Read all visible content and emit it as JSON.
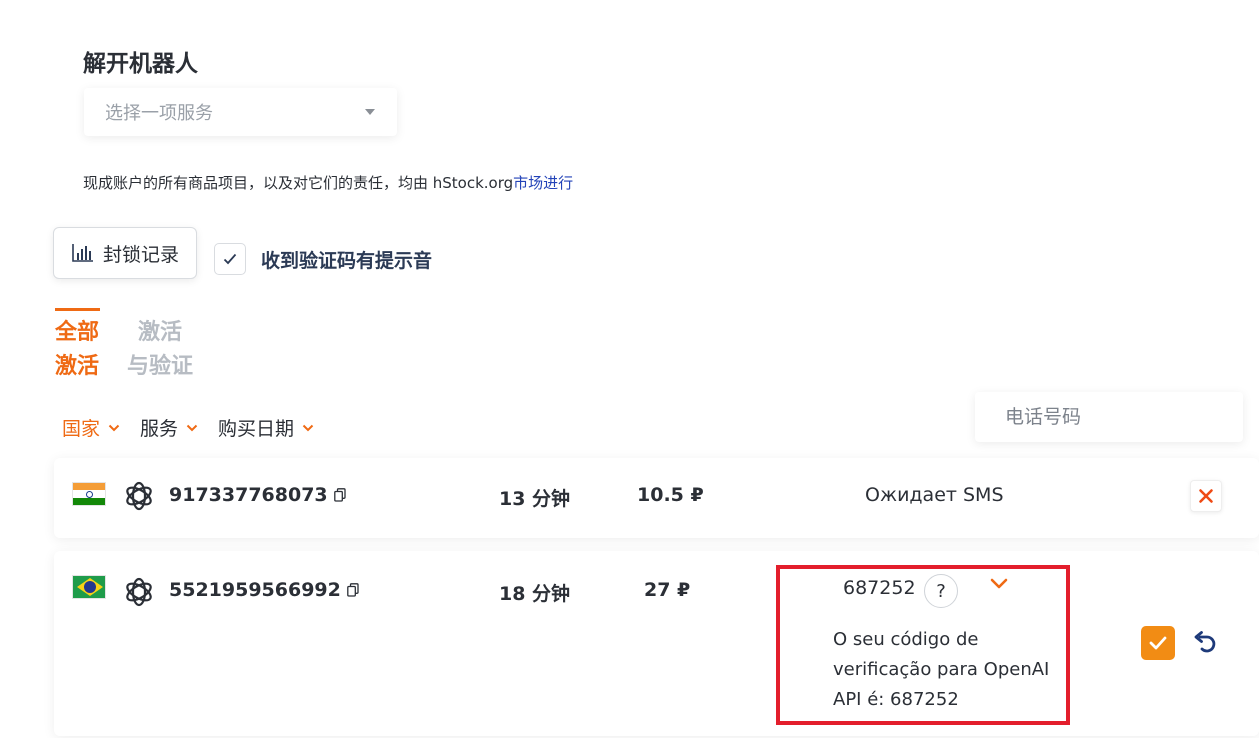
{
  "page": {
    "title": "解开机器人"
  },
  "service_select": {
    "placeholder": "选择一项服务"
  },
  "notice": {
    "text": "现成账户的所有商品项目，以及对它们的责任，均由 hStock.org",
    "link": "市场进行"
  },
  "block_log": {
    "label": "封锁记录"
  },
  "sound": {
    "checked": true,
    "label": "收到验证码有提示音"
  },
  "tabs": [
    {
      "line1": "全部",
      "line2": "激活",
      "active": true
    },
    {
      "line1": "激活",
      "line2": "与验证",
      "active": false
    }
  ],
  "filters": [
    {
      "label": "国家",
      "active": true
    },
    {
      "label": "服务",
      "active": false
    },
    {
      "label": "购买日期",
      "active": false
    }
  ],
  "phone_search": {
    "placeholder": "电话号码"
  },
  "rows": [
    {
      "country": "India",
      "service_icon": "openai-icon",
      "number": "917337768073",
      "duration": "13 分钟",
      "price": "10.5 ₽",
      "status": "Ожидает SMS",
      "action": "cancel"
    },
    {
      "country": "Brazil",
      "service_icon": "openai-icon",
      "number": "5521959566992",
      "duration": "18 分钟",
      "price": "27 ₽",
      "code": "687252",
      "help": "?",
      "sms": "O seu código de verificação para OpenAI API é: 687252",
      "action": "confirm"
    }
  ],
  "colors": {
    "accent": "#ef6a14",
    "confirm": "#f28c14",
    "link": "#2343b8",
    "highlight": "#e31e2c",
    "muted": "#b7bcc3"
  }
}
